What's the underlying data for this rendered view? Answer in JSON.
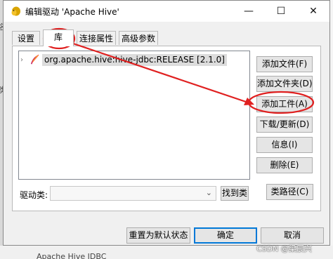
{
  "window": {
    "title": "编辑驱动 'Apache Hive'",
    "minimize_label": "—",
    "maximize_label": "☐",
    "close_label": "✕",
    "icon": "squirrel-icon"
  },
  "tabs": [
    {
      "label": "设置",
      "active": false
    },
    {
      "label": "库",
      "active": true
    },
    {
      "label": "连接属性",
      "active": false
    },
    {
      "label": "高级参数",
      "active": false
    }
  ],
  "library": {
    "items": [
      {
        "label": "org.apache.hive:hive-jdbc:RELEASE [2.1.0]",
        "expander": "›",
        "icon": "maven-feather-icon"
      }
    ]
  },
  "side_buttons": {
    "add_file": "添加文件(F)",
    "add_folder": "添加文件夹(D)",
    "add_artifact": "添加工件(A)",
    "download_update": "下载/更新(D)",
    "info": "信息(I)",
    "delete": "删除(E)",
    "classpath": "类路径(C)"
  },
  "driver_class": {
    "label": "驱动类:",
    "value": "",
    "find_button": "找到类"
  },
  "footer": {
    "reset_default": "重置为默认状态",
    "ok": "确定",
    "cancel": "取消"
  },
  "background": {
    "bottom_text": "Apache Hive JDBC",
    "left_fragment_1": "名",
    "left_fragment_2": "类"
  },
  "watermark": "CSDN @梁辰兴",
  "colors": {
    "annotation_red": "#e02020",
    "primary_border": "#0078d7",
    "selection_bg": "#dcdcdc"
  }
}
